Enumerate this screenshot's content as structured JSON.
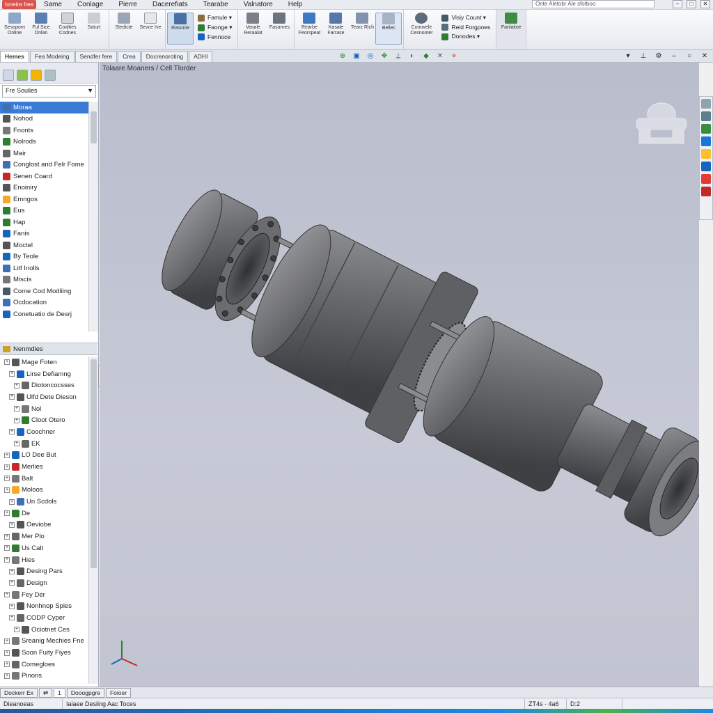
{
  "app": {
    "app_button_label": "Ionetre free"
  },
  "menu": [
    "Same",
    "Conlage",
    "Pierre",
    "Dacerefiats",
    "Tearabe",
    "Valnatore",
    "Help"
  ],
  "search": {
    "placeholder": "Onte Aletobr Ale sfotboo"
  },
  "window_controls": [
    "–",
    "□",
    "✕"
  ],
  "ribbon": {
    "group1": [
      {
        "label": "Sesoporn Online"
      },
      {
        "label": "Ful Sice Onlan"
      },
      {
        "label": "Coalties Codnes"
      },
      {
        "label": "Saturt"
      }
    ],
    "group2": [
      {
        "label": "Stedicte"
      },
      {
        "label": "Sevce Ive"
      }
    ],
    "group3": [
      {
        "label": "Rasonie"
      }
    ],
    "group3_small": [
      {
        "label": "Famule ▾",
        "color": "#8a6d3b"
      },
      {
        "label": "Faonge ▾",
        "color": "#2e7d32"
      },
      {
        "label": "Fennoce",
        "color": "#1565c0"
      }
    ],
    "group4": [
      {
        "label": "Vasale Reraalat"
      },
      {
        "label": "Fasarnes"
      }
    ],
    "group5": [
      {
        "label": "Rearbe Feorspeat"
      },
      {
        "label": "Kasale Farrase"
      },
      {
        "label": "Tearz Rich"
      },
      {
        "label": "Bellec"
      }
    ],
    "group6": [
      {
        "label": "Conovele Cesnooter"
      }
    ],
    "group6_small": [
      {
        "label": "Visiy Count ▾",
        "color": "#455a64"
      },
      {
        "label": "Reid Forgpoes",
        "color": "#546e7a"
      },
      {
        "label": "Donodes ▾",
        "color": "#2e7d32"
      }
    ],
    "group7": [
      {
        "label": "Fanlaitoe"
      }
    ]
  },
  "tabs": [
    "Hemes",
    "Fea Modeing",
    "Sendfer fere",
    "Crea",
    "Docrenoroting",
    "ADHI"
  ],
  "breadcrumb": "Tolaare Moaners / Cell Tlorder",
  "left_panel": {
    "dropdown_value": "Fre Soulies",
    "features": [
      {
        "label": "Moraa",
        "color": "#3f6fb5"
      },
      {
        "label": "Nohod",
        "color": "#555"
      },
      {
        "label": "Fnonts",
        "color": "#777"
      },
      {
        "label": "Nolrods",
        "color": "#2e7d32"
      },
      {
        "label": "Mair",
        "color": "#666"
      },
      {
        "label": "Conglost and Felr Fome",
        "color": "#3f6fb5"
      },
      {
        "label": "Senen Coard",
        "color": "#c62828"
      },
      {
        "label": "Enoiniry",
        "color": "#555"
      },
      {
        "label": "Emngos",
        "color": "#f9a825"
      },
      {
        "label": "Eus",
        "color": "#2e7d32"
      },
      {
        "label": "Hap",
        "color": "#2e7d32"
      },
      {
        "label": "Fanis",
        "color": "#1565c0"
      },
      {
        "label": "Moctel",
        "color": "#555"
      },
      {
        "label": "By Teole",
        "color": "#1565c0"
      },
      {
        "label": "Litf Inolls",
        "color": "#3f6fb5"
      },
      {
        "label": "Miscis",
        "color": "#777"
      },
      {
        "label": "Come Cod Modliing",
        "color": "#455a64"
      },
      {
        "label": "Ocdocation",
        "color": "#3f6fb5"
      },
      {
        "label": "Conetuatio de Desrj",
        "color": "#1565c0"
      }
    ],
    "section_header": "Nenmdies",
    "tree": [
      {
        "label": "Mage Foten",
        "color": "#555"
      },
      {
        "label": "Lirse Defiamng",
        "color": "#1565c0"
      },
      {
        "label": "Diotoncocsses",
        "color": "#666"
      },
      {
        "label": "Ulfd Dete Dieson",
        "color": "#555"
      },
      {
        "label": "Nol",
        "color": "#777"
      },
      {
        "label": "Cloot Otero",
        "color": "#2e7d32"
      },
      {
        "label": "Coochner",
        "color": "#1565c0"
      },
      {
        "label": "EK",
        "color": "#666"
      },
      {
        "label": "LO Dee But",
        "color": "#1565c0"
      },
      {
        "label": "Merlies",
        "color": "#c62828"
      },
      {
        "label": "Balt",
        "color": "#777"
      },
      {
        "label": "Moloos",
        "color": "#f9a825"
      },
      {
        "label": "Un Scdols",
        "color": "#3f6fb5"
      },
      {
        "label": "De",
        "color": "#2e7d32"
      },
      {
        "label": "Oeviobe",
        "color": "#555"
      },
      {
        "label": "Mer Plo",
        "color": "#666"
      },
      {
        "label": "Us Calt",
        "color": "#2e7d32"
      },
      {
        "label": "Hies",
        "color": "#777"
      },
      {
        "label": "Desing Pars",
        "color": "#555"
      },
      {
        "label": "Design",
        "color": "#666"
      },
      {
        "label": "Fey Der",
        "color": "#777"
      },
      {
        "label": "Nonhnop Spies",
        "color": "#555"
      },
      {
        "label": "CODP Cyper",
        "color": "#666"
      },
      {
        "label": "Ociotnet Ces",
        "color": "#555"
      },
      {
        "label": "Sreanig Mechies Fne",
        "color": "#777"
      },
      {
        "label": "Soon Fuity Fiyes",
        "color": "#555"
      },
      {
        "label": "Comegloes",
        "color": "#666"
      },
      {
        "label": "Pinons",
        "color": "#777"
      }
    ]
  },
  "bottom_tabs": [
    "Dockerr Ex",
    "1",
    "Dooogpgre",
    "Foioer"
  ],
  "status": {
    "cell1": "Dieanoeas",
    "cell2": "Iaiaee Desiing Aac Toces",
    "coords": "ZT4s · 4a6",
    "cell4": "D:2"
  },
  "colors": {
    "accent": "#3a7bd5",
    "viewport_bg": "#c1c4d1",
    "model": "#6e6f73"
  }
}
